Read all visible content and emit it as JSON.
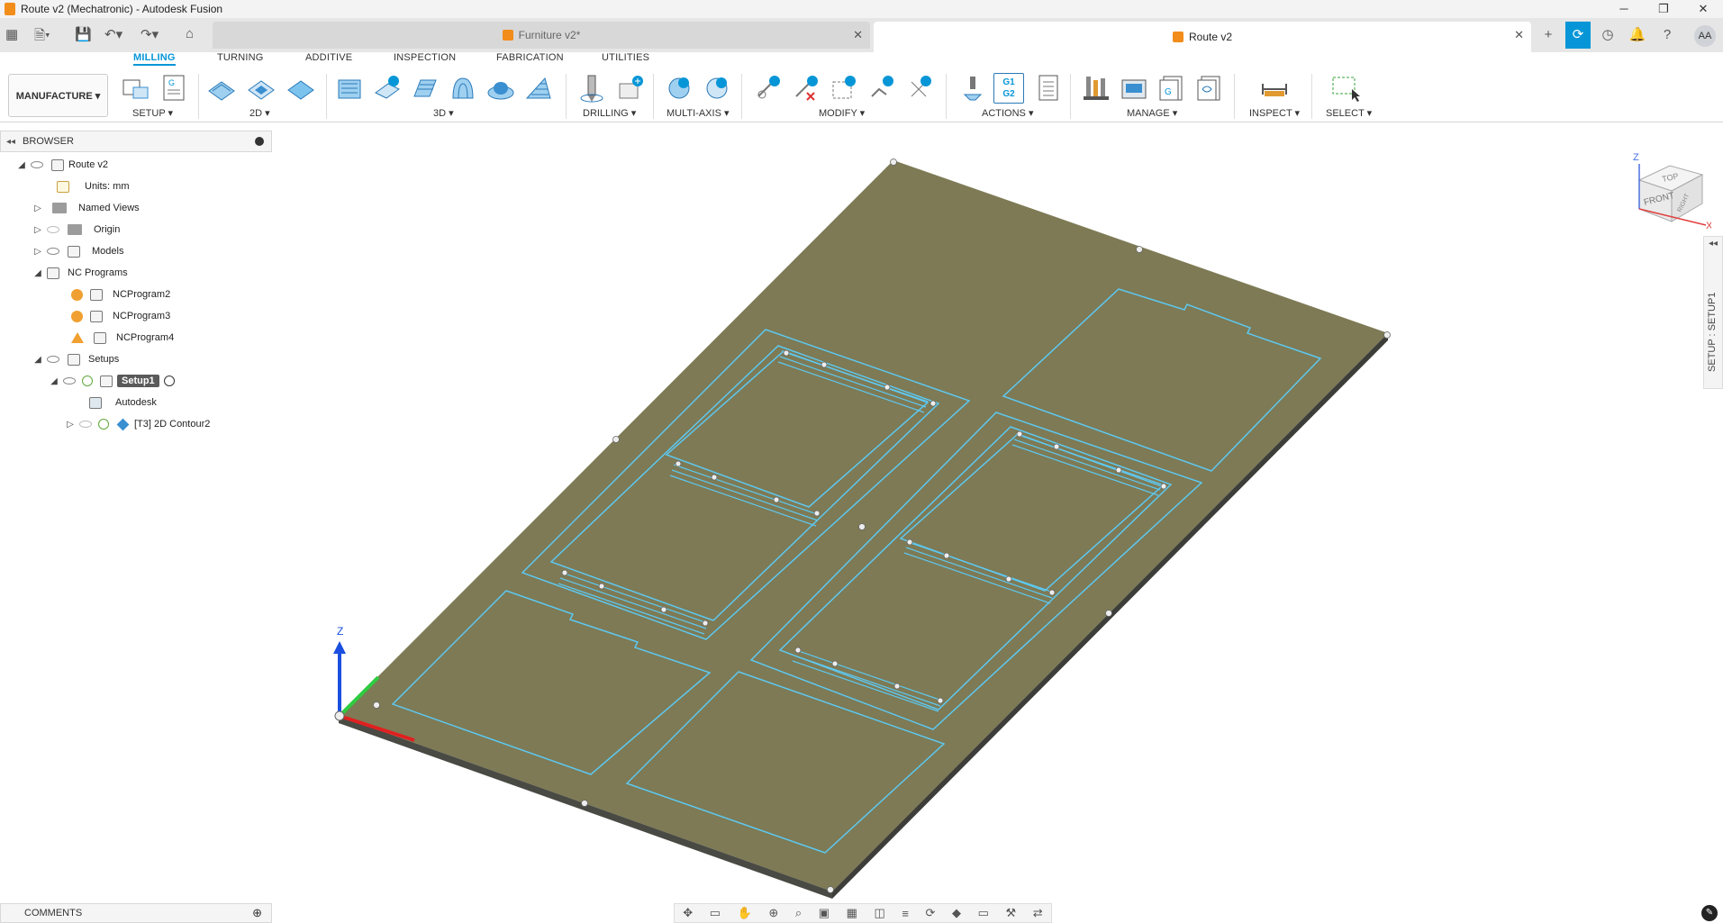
{
  "window": {
    "title": "Route v2 (Mechatronic) - Autodesk Fusion",
    "controls": [
      "─",
      "❐",
      "✕"
    ]
  },
  "tabs": {
    "items": [
      {
        "label": "Furniture v2*",
        "active": false
      },
      {
        "label": "Route v2",
        "active": true
      }
    ],
    "new_tab": "+",
    "avatar": "AA"
  },
  "ribbon": {
    "workspace": "MANUFACTURE ▾",
    "tabs": [
      "MILLING",
      "TURNING",
      "ADDITIVE",
      "INSPECTION",
      "FABRICATION",
      "UTILITIES"
    ],
    "groups": [
      "SETUP ▾",
      "2D ▾",
      "3D ▾",
      "DRILLING ▾",
      "MULTI-AXIS ▾",
      "MODIFY ▾",
      "ACTIONS ▾",
      "MANAGE ▾",
      "INSPECT ▾",
      "SELECT ▾"
    ],
    "actions_icon_text": "G1\nG2"
  },
  "browser": {
    "title": "BROWSER",
    "items": [
      {
        "label": "Route v2"
      },
      {
        "label": "Units: mm"
      },
      {
        "label": "Named Views"
      },
      {
        "label": "Origin"
      },
      {
        "label": "Models"
      },
      {
        "label": "NC Programs"
      },
      {
        "label": "NCProgram2"
      },
      {
        "label": "NCProgram3"
      },
      {
        "label": "NCProgram4"
      },
      {
        "label": "Setups"
      },
      {
        "label": "Setup1"
      },
      {
        "label": "Autodesk"
      },
      {
        "label": "[T3] 2D Contour2"
      }
    ]
  },
  "viewport": {
    "viewcube": {
      "top": "TOP",
      "front": "FRONT",
      "right": "RIGHT",
      "x": "X",
      "z": "Z"
    },
    "axis_z": "Z",
    "side_panel": "SETUP : SETUP1"
  },
  "comments": {
    "title": "COMMENTS"
  },
  "colors": {
    "accent": "#0696d7",
    "stock": "#7d7a55",
    "toolpath": "#5ec8f0",
    "x_axis": "#e02020",
    "y_axis": "#2ecc40",
    "z_axis": "#1a4fe0"
  }
}
